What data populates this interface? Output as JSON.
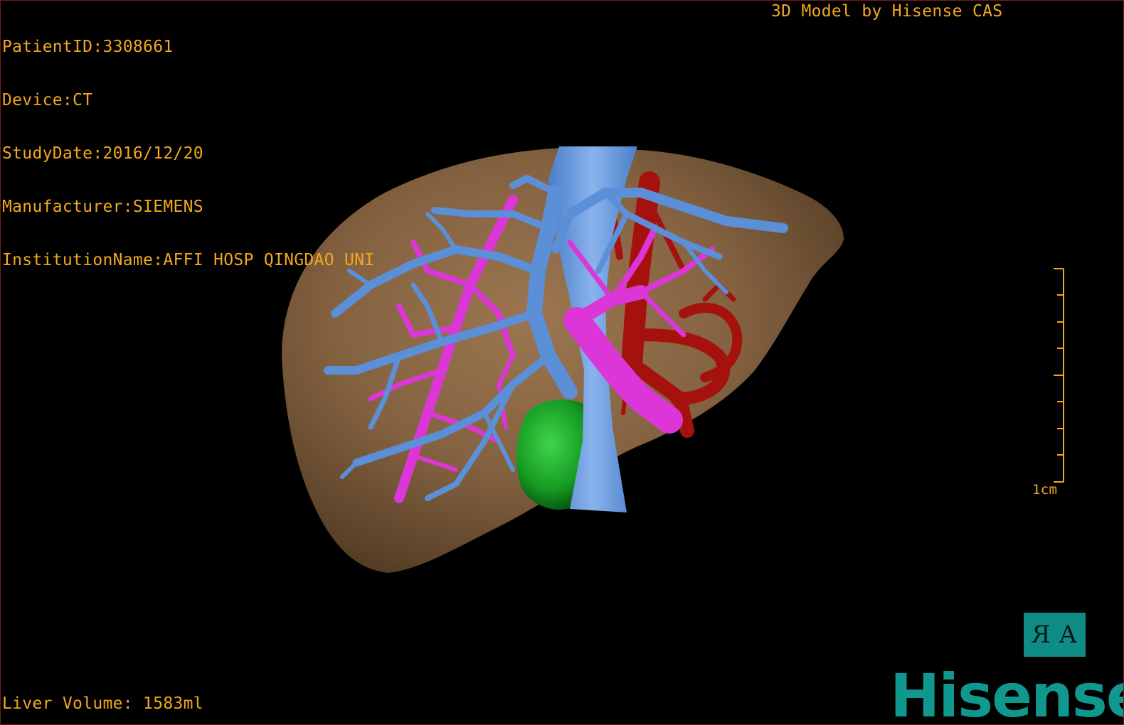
{
  "viewer": {
    "info": [
      "PatientID:3308661",
      "Device:CT",
      "StudyDate:2016/12/20",
      "Manufacturer:SIEMENS",
      "InstitutionName:AFFI HOSP QINGDAO UNI"
    ],
    "credit": "3D Model by Hisense CAS",
    "volume": "Liver Volume: 1583ml",
    "scale_label": "1cm"
  },
  "orientation": {
    "left": "R",
    "right": "A"
  },
  "brand": "Hisense",
  "colors": {
    "overlay_text": "#f2a81d",
    "liver": "#8f6a47",
    "portal_vein": "#5b8fd8",
    "hepatic_vein": "#dc36d8",
    "artery": "#a5120e",
    "gallbladder": "#1a9e24",
    "brand": "#11988e"
  }
}
